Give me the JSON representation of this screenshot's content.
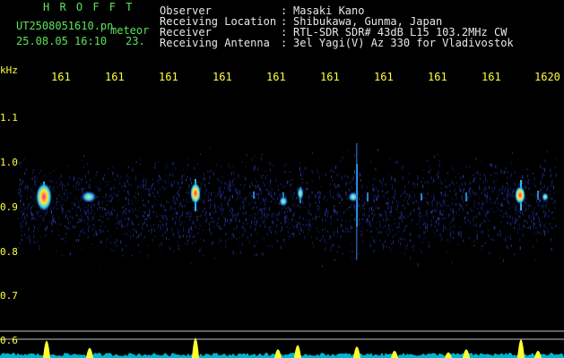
{
  "header": {
    "station": "H R O F F T",
    "filename": "UT2508051610.pn",
    "tag": "meteor",
    "datetime": "25.08.05 16:10",
    "count": "23.",
    "fields": [
      {
        "label": "Observer",
        "value": "Masaki Kano"
      },
      {
        "label": "Receiving Location",
        "value": "Shibukawa, Gunma, Japan"
      },
      {
        "label": "Receiver",
        "value": "RTL-SDR SDR# 43dB L15 103.2MHz CW"
      },
      {
        "label": "Receiving Antenna",
        "value": "3el Yagi(V) Az 330 for Vladivostok"
      }
    ]
  },
  "axis": {
    "unit": "kHz",
    "time_ticks": [
      "161",
      "161",
      "161",
      "161",
      "161",
      "161",
      "161",
      "161",
      "161",
      "1620"
    ],
    "freq_ticks": [
      "1.1",
      "1.0",
      "0.9",
      "0.8",
      "0.7",
      "0.6"
    ]
  },
  "colors": {
    "background": "#000000",
    "grid": "#cccccc",
    "axis_text": "#ffff40",
    "title_green": "#5be35b",
    "baseline": "#00e5ff"
  }
}
